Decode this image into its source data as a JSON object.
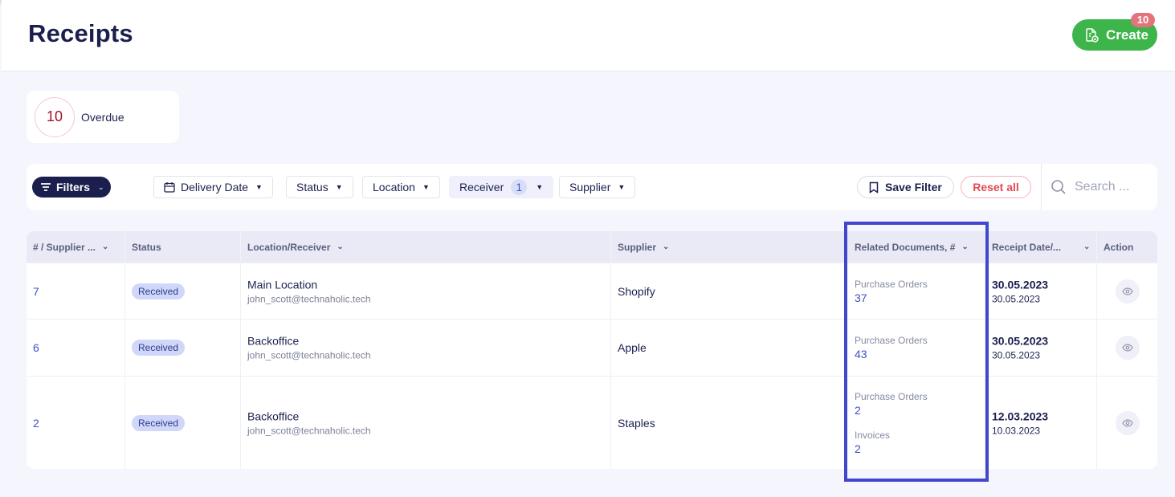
{
  "header": {
    "title": "Receipts",
    "create_label": "Create",
    "create_badge": "10"
  },
  "overdue": {
    "count": "10",
    "label": "Overdue"
  },
  "filters": {
    "filters_label": "Filters",
    "chips": [
      {
        "label": "Delivery Date",
        "icon": "calendar-icon"
      },
      {
        "label": "Status"
      },
      {
        "label": "Location"
      },
      {
        "label": "Receiver",
        "count": "1",
        "active": true
      },
      {
        "label": "Supplier"
      }
    ],
    "save_filter_label": "Save Filter",
    "reset_all_label": "Reset all",
    "search_placeholder": "Search ..."
  },
  "table": {
    "columns": [
      {
        "label": "# / Supplier ...",
        "sortable": true
      },
      {
        "label": "Status",
        "sortable": false
      },
      {
        "label": "Location/Receiver",
        "sortable": true
      },
      {
        "label": "Supplier",
        "sortable": true
      },
      {
        "label": "Related Documents, #",
        "sortable": true
      },
      {
        "label": "Receipt Date/...",
        "sortable": true
      },
      {
        "label": "Action",
        "sortable": false
      }
    ],
    "rows": [
      {
        "number": "7",
        "status": "Received",
        "location": "Main Location",
        "receiver": "john_scott@technaholic.tech",
        "supplier": "Shopify",
        "documents": [
          {
            "label": "Purchase Orders",
            "count": "37"
          }
        ],
        "receipt_date": "30.05.2023",
        "sub_date": "30.05.2023"
      },
      {
        "number": "6",
        "status": "Received",
        "location": "Backoffice",
        "receiver": "john_scott@technaholic.tech",
        "supplier": "Apple",
        "documents": [
          {
            "label": "Purchase Orders",
            "count": "43"
          }
        ],
        "receipt_date": "30.05.2023",
        "sub_date": "30.05.2023"
      },
      {
        "number": "2",
        "status": "Received",
        "location": "Backoffice",
        "receiver": "john_scott@technaholic.tech",
        "supplier": "Staples",
        "documents": [
          {
            "label": "Purchase Orders",
            "count": "2"
          },
          {
            "label": "Invoices",
            "count": "2"
          }
        ],
        "receipt_date": "12.03.2023",
        "sub_date": "10.03.2023"
      }
    ]
  },
  "colors": {
    "brand_navy": "#1b1f4d",
    "create_green": "#3db54a",
    "link_blue": "#3f4fc4",
    "reset_red": "#e54857",
    "highlight_border": "#4147cc"
  }
}
